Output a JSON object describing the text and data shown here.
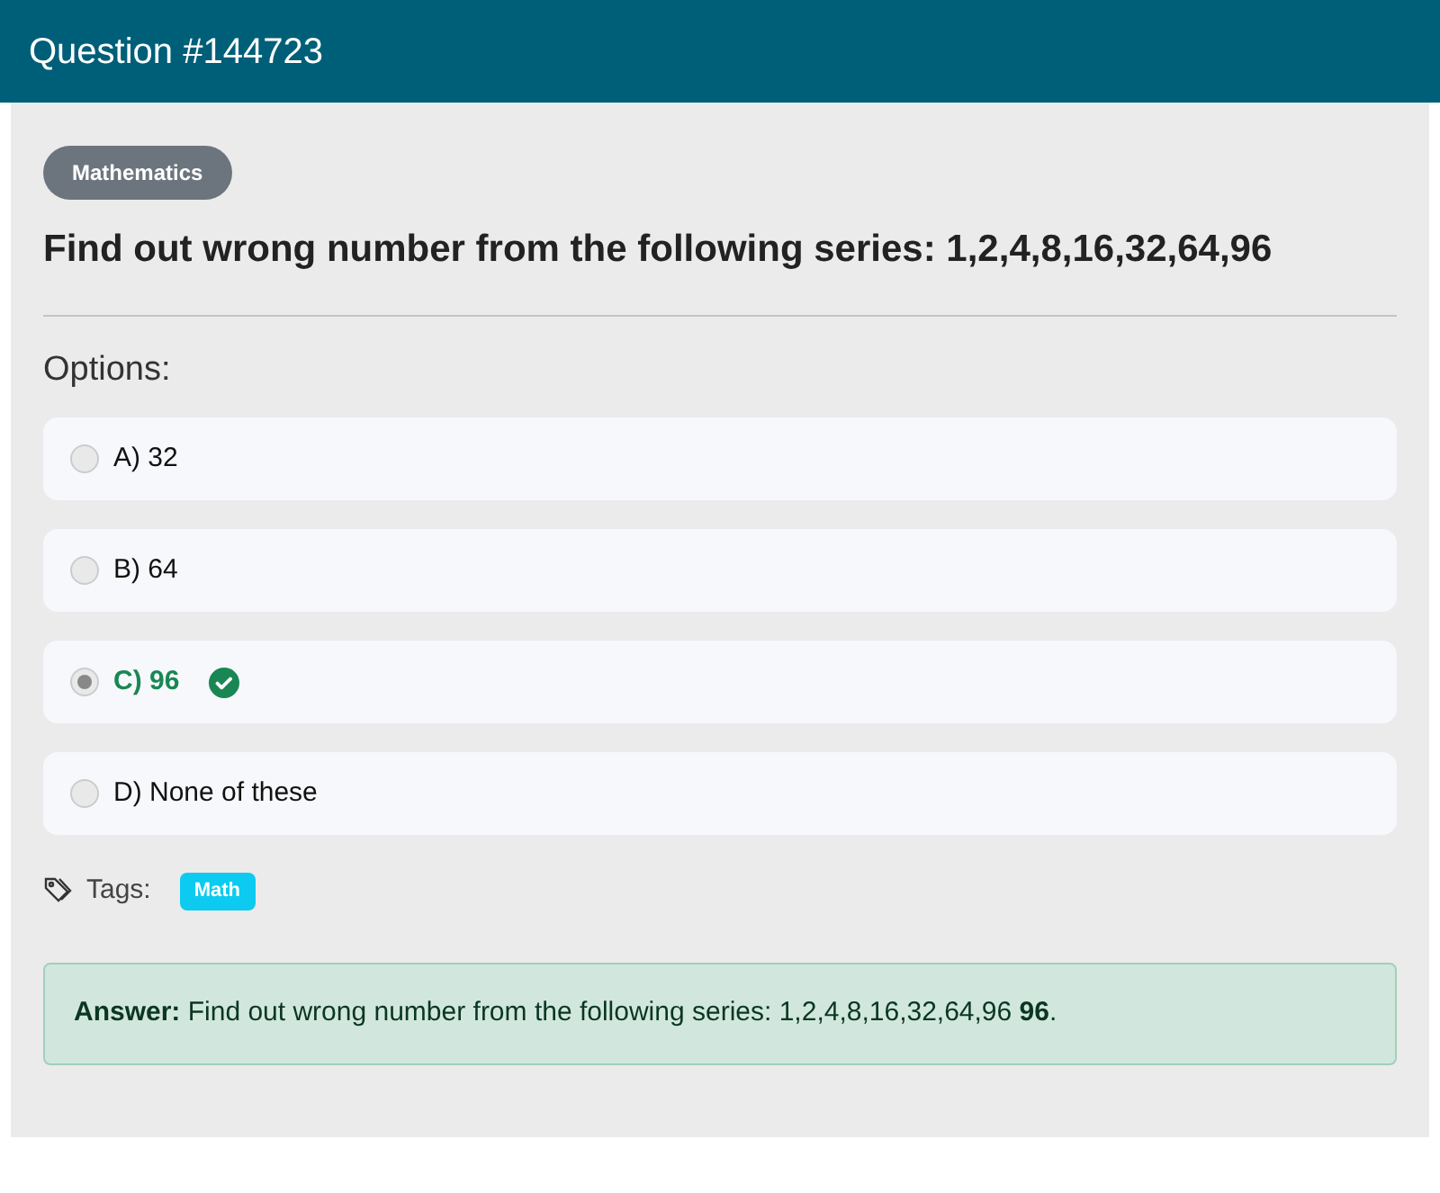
{
  "header": {
    "title": "Question #144723"
  },
  "category": "Mathematics",
  "question": "Find out wrong number from the following series: 1,2,4,8,16,32,64,96",
  "options_label": "Options:",
  "options": [
    {
      "label": "A) 32",
      "selected": false,
      "correct": false
    },
    {
      "label": "B) 64",
      "selected": false,
      "correct": false
    },
    {
      "label": "C) 96",
      "selected": true,
      "correct": true
    },
    {
      "label": "D) None of these",
      "selected": false,
      "correct": false
    }
  ],
  "tags_label": "Tags:",
  "tags": [
    "Math"
  ],
  "answer": "**Answer:** Find out wrong number from the following series: 1,2,4,8,16,32,64,96 **96**."
}
